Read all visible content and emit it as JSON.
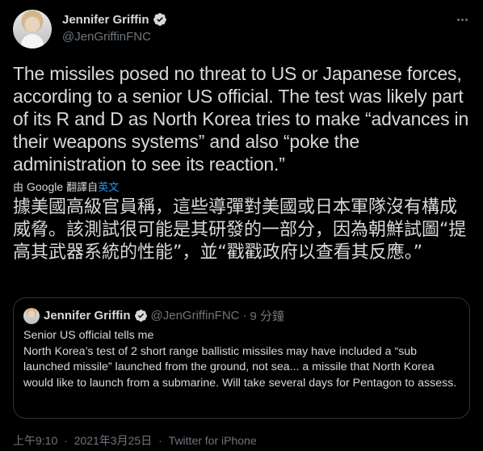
{
  "author": {
    "name": "Jennifer Griffin",
    "handle": "@JenGriffinFNC"
  },
  "tweet": {
    "text": "The missiles posed no threat to US or Japanese forces, according to a senior US official. The test was likely part of its R and D as North Korea tries to make “advances in their weapons systems” and also “poke the administration to see its reaction.”"
  },
  "translation": {
    "by_label": "由",
    "provider": "Google",
    "action_label": "翻譯自",
    "source_lang": "英文",
    "text": "據美國高級官員稱，這些導彈對美國或日本軍隊沒有構成威脅。該測試很可能是其研發的一部分，因為朝鮮試圖“提高其武器系統的性能”，並“戳戳政府以查看其反應。”"
  },
  "quoted_tweet": {
    "name": "Jennifer Griffin",
    "handle": "@JenGriffinFNC",
    "separator": "·",
    "time": "9 分鐘",
    "text_line1": "Senior US official tells me",
    "text_body": "North Korea’s test of 2 short range ballistic missiles may have included a “sub launched missile” launched from the ground, not sea... a missile that North Korea would like to launch from a submarine. Will take several days for Pentagon to assess."
  },
  "meta": {
    "time": "上午9:10",
    "separator": "·",
    "date": "2021年3月25日",
    "source": "Twitter for iPhone"
  },
  "colors": {
    "background": "#000000",
    "text": "#d9d9d9",
    "secondary": "#6e767d",
    "accent": "#1d9bf0",
    "border": "#2f3336"
  },
  "icons": [
    "verified-badge-icon",
    "more-options-icon"
  ]
}
